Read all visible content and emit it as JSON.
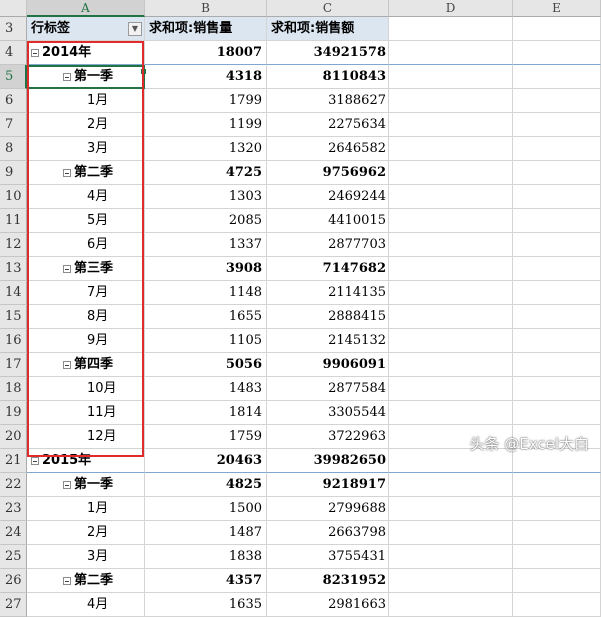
{
  "columns": [
    "A",
    "B",
    "C",
    "D",
    "E"
  ],
  "header_row": {
    "row_number": "3",
    "row_label": "行标签",
    "sum_quantity": "求和项:销售量",
    "sum_amount": "求和项:销售额"
  },
  "rows": [
    {
      "row": "4",
      "label": "2014年",
      "qty": "18007",
      "amt": "34921578",
      "level": "year"
    },
    {
      "row": "5",
      "label": "第一季",
      "qty": "4318",
      "amt": "8110843",
      "level": "quarter"
    },
    {
      "row": "6",
      "label": "1月",
      "qty": "1799",
      "amt": "3188627",
      "level": "month"
    },
    {
      "row": "7",
      "label": "2月",
      "qty": "1199",
      "amt": "2275634",
      "level": "month"
    },
    {
      "row": "8",
      "label": "3月",
      "qty": "1320",
      "amt": "2646582",
      "level": "month"
    },
    {
      "row": "9",
      "label": "第二季",
      "qty": "4725",
      "amt": "9756962",
      "level": "quarter"
    },
    {
      "row": "10",
      "label": "4月",
      "qty": "1303",
      "amt": "2469244",
      "level": "month"
    },
    {
      "row": "11",
      "label": "5月",
      "qty": "2085",
      "amt": "4410015",
      "level": "month"
    },
    {
      "row": "12",
      "label": "6月",
      "qty": "1337",
      "amt": "2877703",
      "level": "month"
    },
    {
      "row": "13",
      "label": "第三季",
      "qty": "3908",
      "amt": "7147682",
      "level": "quarter"
    },
    {
      "row": "14",
      "label": "7月",
      "qty": "1148",
      "amt": "2114135",
      "level": "month"
    },
    {
      "row": "15",
      "label": "8月",
      "qty": "1655",
      "amt": "2888415",
      "level": "month"
    },
    {
      "row": "16",
      "label": "9月",
      "qty": "1105",
      "amt": "2145132",
      "level": "month"
    },
    {
      "row": "17",
      "label": "第四季",
      "qty": "5056",
      "amt": "9906091",
      "level": "quarter"
    },
    {
      "row": "18",
      "label": "10月",
      "qty": "1483",
      "amt": "2877584",
      "level": "month"
    },
    {
      "row": "19",
      "label": "11月",
      "qty": "1814",
      "amt": "3305544",
      "level": "month"
    },
    {
      "row": "20",
      "label": "12月",
      "qty": "1759",
      "amt": "3722963",
      "level": "month"
    },
    {
      "row": "21",
      "label": "2015年",
      "qty": "20463",
      "amt": "39982650",
      "level": "year"
    },
    {
      "row": "22",
      "label": "第一季",
      "qty": "4825",
      "amt": "9218917",
      "level": "quarter"
    },
    {
      "row": "23",
      "label": "1月",
      "qty": "1500",
      "amt": "2799688",
      "level": "month"
    },
    {
      "row": "24",
      "label": "2月",
      "qty": "1487",
      "amt": "2663798",
      "level": "month"
    },
    {
      "row": "25",
      "label": "3月",
      "qty": "1838",
      "amt": "3755431",
      "level": "month"
    },
    {
      "row": "26",
      "label": "第二季",
      "qty": "4357",
      "amt": "8231952",
      "level": "quarter"
    },
    {
      "row": "27",
      "label": "4月",
      "qty": "1635",
      "amt": "2981663",
      "level": "month"
    }
  ],
  "active_cell": "A5",
  "watermark": "头条 @Excel大白",
  "colors": {
    "header_fill": "#dce6f1",
    "selection_green": "#217346",
    "highlight_frame": "#e02b2b"
  },
  "icons": {
    "filter_dropdown": "dropdown-arrow-icon",
    "collapse_toggle": "collapse-minus-icon"
  }
}
